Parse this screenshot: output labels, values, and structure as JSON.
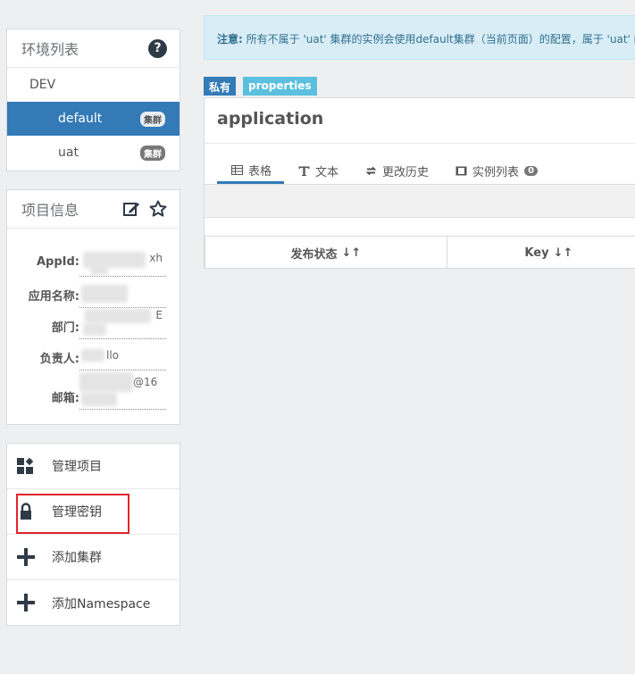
{
  "env": {
    "title": "环境列表",
    "help_glyph": "?",
    "items": [
      {
        "label": "DEV"
      },
      {
        "label": "default",
        "badge": "集群",
        "selected": true
      },
      {
        "label": "uat",
        "badge": "集群"
      }
    ]
  },
  "project": {
    "title": "项目信息",
    "fields": [
      {
        "label": "AppId:",
        "value_suffix": "xh"
      },
      {
        "label": "应用名称:",
        "value_suffix": ""
      },
      {
        "label": "部门:",
        "value_suffix": "E"
      },
      {
        "label": "负责人:",
        "value_suffix": "llo"
      },
      {
        "label": "邮箱:",
        "value_suffix": "@16"
      }
    ]
  },
  "actions": [
    {
      "label": "管理项目",
      "icon": "apps-icon"
    },
    {
      "label": "管理密钥",
      "icon": "lock-icon",
      "highlighted": true
    },
    {
      "label": "添加集群",
      "icon": "plus-icon"
    },
    {
      "label": "添加Namespace",
      "icon": "plus-icon"
    }
  ],
  "notice": {
    "prefix": "注意:",
    "text": " 所有不属于 'uat' 集群的实例会使用default集群（当前页面）的配置，属于 'uat' 的"
  },
  "namespace": {
    "tag_private": "私有",
    "tag_format": "properties",
    "name": "application",
    "tabs": [
      {
        "label": "表格",
        "icon": "table-icon",
        "active": true
      },
      {
        "label": "文本",
        "icon": "text-icon"
      },
      {
        "label": "更改历史",
        "icon": "history-icon"
      },
      {
        "label": "实例列表",
        "icon": "instance-icon",
        "count": "0"
      }
    ],
    "columns": [
      {
        "label": "发布状态",
        "sort_glyph": "↓↑"
      },
      {
        "label": "Key",
        "sort_glyph": "↓↑"
      }
    ]
  },
  "colors": {
    "primary": "#337ab7",
    "info": "#5bc0de",
    "highlight": "#e0242b"
  }
}
